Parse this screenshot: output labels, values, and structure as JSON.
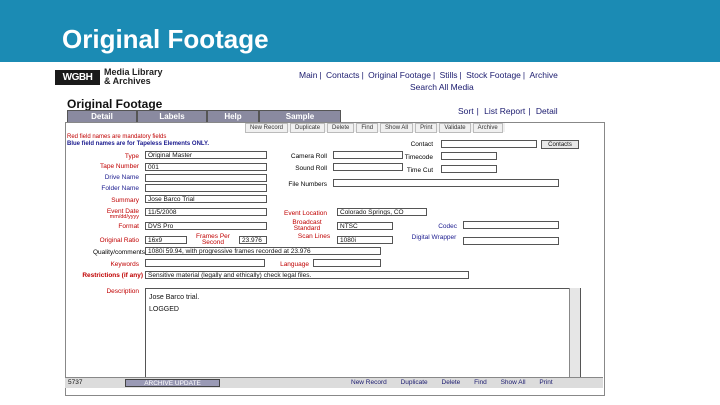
{
  "slide": {
    "title": "Original Footage"
  },
  "header": {
    "logo": "WGBH",
    "logo_line1": "Media Library",
    "logo_line2": "& Archives",
    "nav": [
      "Main",
      "Contacts",
      "Original Footage",
      "Stills",
      "Stock Footage",
      "Archive"
    ],
    "search_all": "Search All Media"
  },
  "form": {
    "title": "Original Footage",
    "sort_links": [
      "Sort",
      "List Report",
      "Detail"
    ],
    "tabs": [
      "Detail",
      "Labels",
      "Help",
      "Sample"
    ],
    "toolbar": [
      "New Record",
      "Duplicate",
      "Delete",
      "Find",
      "Show All",
      "Print",
      "Validate",
      "Archive"
    ],
    "hint_red": "Red field names are mandatory fields",
    "hint_blue": "Blue field names are for Tapeless Elements ONLY.",
    "labels": {
      "type": "Type",
      "tape_number": "Tape Number",
      "drive_name": "Drive Name",
      "folder_name": "Folder Name",
      "summary": "Summary",
      "event_date": "Event Date",
      "event_date_format": "mm/dd/yyyy",
      "format": "Format",
      "original_aspect": "Original Ratio",
      "frames_per_second": "Frames Per Second",
      "quality_comments": "Quality/comments",
      "language": "Language",
      "keywords": "Keywords",
      "restrictions": "Restrictions (if any)",
      "description": "Description",
      "camera_roll": "Camera Roll",
      "sound_roll": "Sound Roll",
      "file_numbers": "File Numbers",
      "event_location": "Event Location",
      "broadcast_standard": "Broadcast Standard",
      "scan_lines": "Scan Lines",
      "contact": "Contact",
      "timecode": "Timecode",
      "time_cut": "Time Cut",
      "codec": "Codec",
      "digital_wrapper": "Digital Wrapper"
    },
    "values": {
      "type": "Original Master",
      "tape_number": "001",
      "summary": "Jose Barco Trial",
      "event_date": "11/5/2008",
      "event_location": "Colorado Springs, CO",
      "format": "DVS Pro",
      "original_aspect": "16x9",
      "frames_per_second": "23.976",
      "broadcast_standard": "NTSC",
      "scan_lines": "1080i",
      "quality_comments": "1080i 59.94, with progressive frames recorded at 23.976",
      "restrictions": "Sensitive material (legally and ethically) check legal files.",
      "description_line1": "Jose Barco trial.",
      "description_line2": "LOGGED"
    },
    "contact_button": "Contacts"
  },
  "statusbar": {
    "record": "5737",
    "archive_update": "ARCHIVE UPDATE",
    "nav": [
      "New Record",
      "Duplicate",
      "Delete",
      "Find",
      "Show All",
      "Print"
    ]
  },
  "colors": {
    "banner": "#1b8bb4",
    "mandatory": "#c00000",
    "tapeless": "#1a1a8e"
  }
}
